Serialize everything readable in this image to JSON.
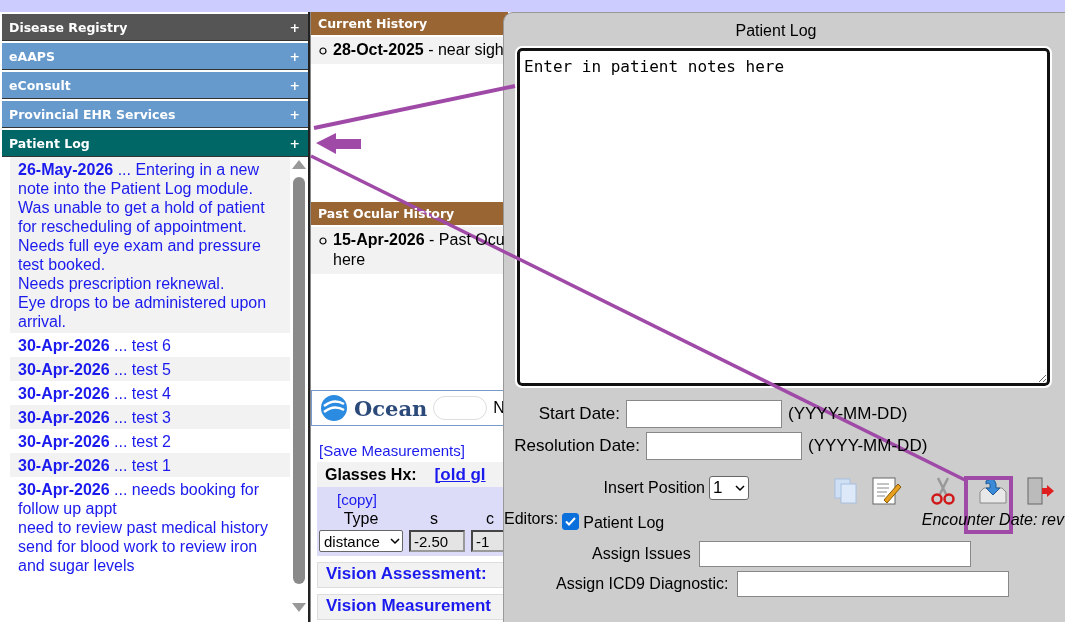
{
  "sidebar": {
    "sections": [
      {
        "title": "Disease Registry",
        "toggle": "+",
        "color": "#555555"
      },
      {
        "title": "eAAPS",
        "toggle": "+",
        "color": "#6699cc"
      },
      {
        "title": "eConsult",
        "toggle": "+",
        "color": "#6699cc"
      },
      {
        "title": "Provincial EHR Services",
        "toggle": "+",
        "color": "#6699cc"
      },
      {
        "title": "Patient Log",
        "toggle": "+",
        "color": "#006666"
      }
    ],
    "notes": [
      {
        "date": "26-May-2026",
        "lines": [
          "... Entering in a new note into the Patient Log module.",
          "Was unable to get a hold of patient for rescheduling of appointment.",
          "Needs full eye exam and pressure test booked.",
          "Needs prescription reknewal.",
          "Eye drops to be administered upon arrival."
        ]
      },
      {
        "date": "30-Apr-2026",
        "lines": [
          "... test 6"
        ]
      },
      {
        "date": "30-Apr-2026",
        "lines": [
          "... test 5"
        ]
      },
      {
        "date": "30-Apr-2026",
        "lines": [
          "... test 4"
        ]
      },
      {
        "date": "30-Apr-2026",
        "lines": [
          "... test 3"
        ]
      },
      {
        "date": "30-Apr-2026",
        "lines": [
          "... test 2"
        ]
      },
      {
        "date": "30-Apr-2026",
        "lines": [
          "... test 1"
        ]
      },
      {
        "date": "30-Apr-2026",
        "lines": [
          "... needs booking for follow up appt",
          "need to review past medical history",
          "send for blood work to review iron and sugar levels"
        ]
      }
    ]
  },
  "middle": {
    "history": [
      {
        "title": "Current History",
        "date": "28-Oct-2025",
        "lines": [
          "- near sigh"
        ]
      },
      {
        "title": "Past Ocular History",
        "date": "15-Apr-2026",
        "lines": [
          "- Past Ocu",
          "here"
        ]
      }
    ],
    "ocean": {
      "logo": "Ocean",
      "toggle_on": false,
      "label": "N"
    },
    "save_link": "[Save Measurements]",
    "glasses": {
      "title": "Glasses Hx:",
      "link": "[old gl",
      "copy": "[copy]",
      "columns": [
        "Type",
        "s",
        "c"
      ],
      "type": "distance",
      "s": "-2.50",
      "c": "-1"
    },
    "sections": [
      "Vision Assessment:",
      "Vision Measurement"
    ]
  },
  "dialog": {
    "title": "Patient Log",
    "notes": "Enter in patient notes here",
    "start_label": "Start Date:",
    "resolution_label": "Resolution Date:",
    "date_hint": "(YYYY-MM-DD)",
    "date_hint_2": "(YYYY-MM-DD)",
    "insert_label": "Insert Position",
    "insert_value": "1",
    "editors_label": "Editors:",
    "editor": {
      "label": "Patient Log",
      "checked": true
    },
    "encounter": "Encounter Date:  rev",
    "issues_label": "Assign Issues",
    "icd_label": "Assign ICD9 Diagnostic:"
  }
}
